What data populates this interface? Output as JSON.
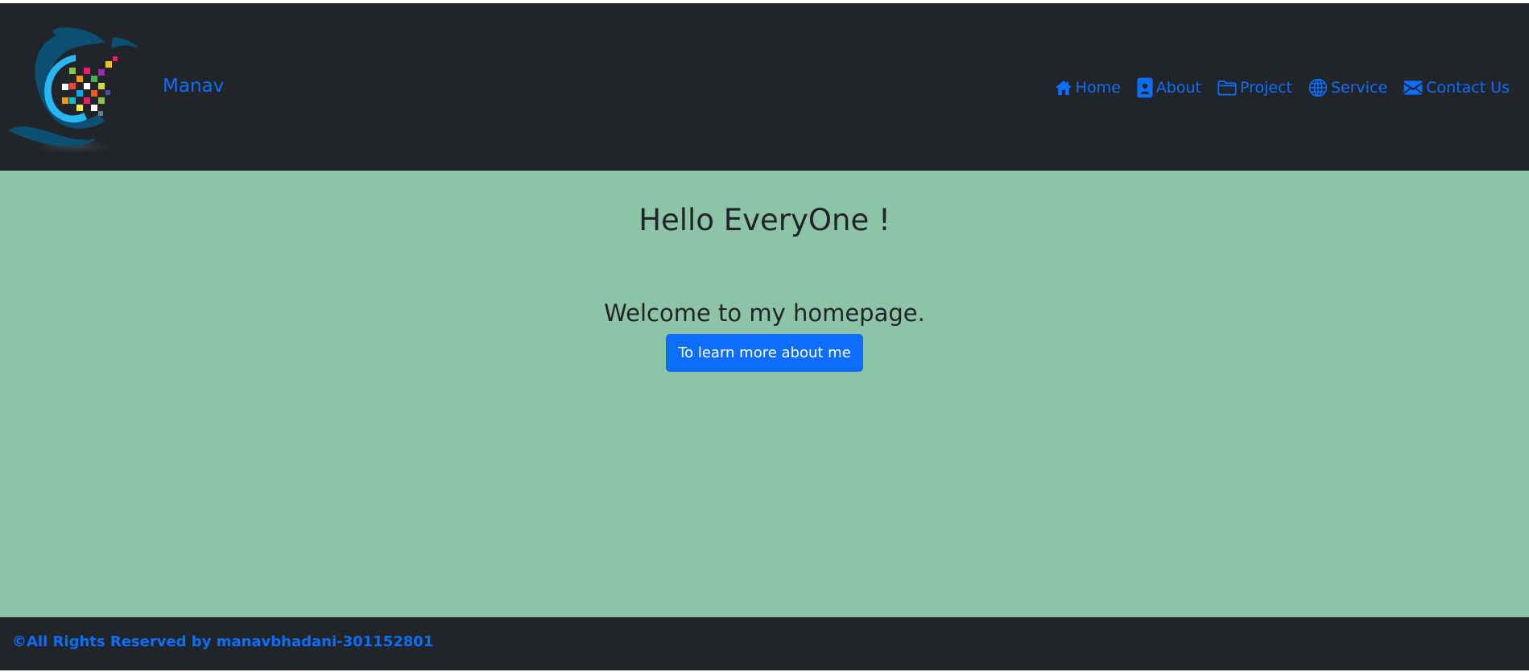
{
  "navbar": {
    "logo_icon": "brand-logo",
    "brand": "Manav",
    "links": [
      {
        "label": "Home",
        "icon": "home-icon"
      },
      {
        "label": "About",
        "icon": "person-badge-icon"
      },
      {
        "label": "Project",
        "icon": "folder-icon"
      },
      {
        "label": "Service",
        "icon": "globe-icon"
      },
      {
        "label": "Contact Us",
        "icon": "envelope-icon"
      }
    ]
  },
  "main": {
    "title": "Hello EveryOne !",
    "subtitle": "Welcome to my homepage.",
    "cta_label": "To learn more about me"
  },
  "footer": {
    "text": "©All Rights Reserved by manavbhadani-301152801"
  },
  "colors": {
    "navbar_bg": "#212529",
    "main_bg": "#8dc3a7",
    "accent": "#0d6efd",
    "text_dark": "#212529"
  }
}
